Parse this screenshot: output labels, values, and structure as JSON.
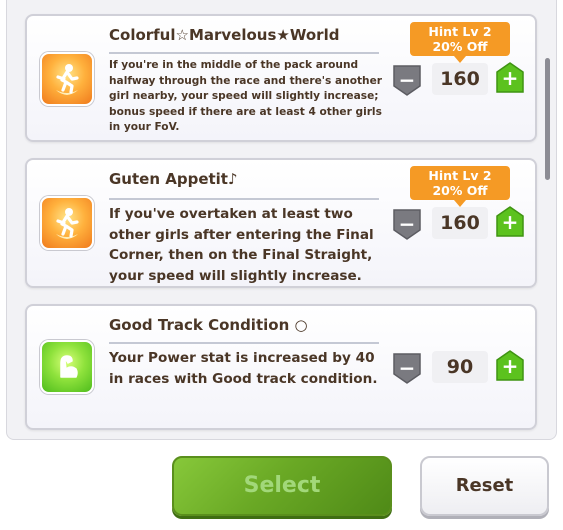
{
  "skills": [
    {
      "name": "Colorful☆Marvelous★World",
      "description": "If you're in the middle of the pack around halfway through the race and there's another girl nearby, your speed will slightly increase; bonus speed if there are at least 4 other girls in your FoV.",
      "hint_level": "Hint Lv 2",
      "discount": "20% Off",
      "cost": "160",
      "icon": "speed-up-runner-icon",
      "icon_color": "#f59a25"
    },
    {
      "name": "Guten Appetit♪",
      "description": "If you've overtaken at least two other girls after entering the Final Corner, then on the Final Straight, your speed will slightly increase.",
      "hint_level": "Hint Lv 2",
      "discount": "20% Off",
      "cost": "160",
      "icon": "speed-up-runner-icon",
      "icon_color": "#f59a25"
    },
    {
      "name": "Good Track Condition ○",
      "description": "Your Power stat is increased by 40 in races with Good track condition.",
      "cost": "90",
      "icon": "power-arm-icon",
      "icon_color": "#6cc92a"
    }
  ],
  "controls": {
    "minus_label": "−",
    "plus_label": "+"
  },
  "footer": {
    "select_label": "Select",
    "reset_label": "Reset"
  },
  "colors": {
    "accent_orange": "#f59a25",
    "select_green": "#6aa925",
    "plus_green": "#5cc21e",
    "minus_gray": "#7a7a80",
    "text_brown": "#4a3626"
  }
}
